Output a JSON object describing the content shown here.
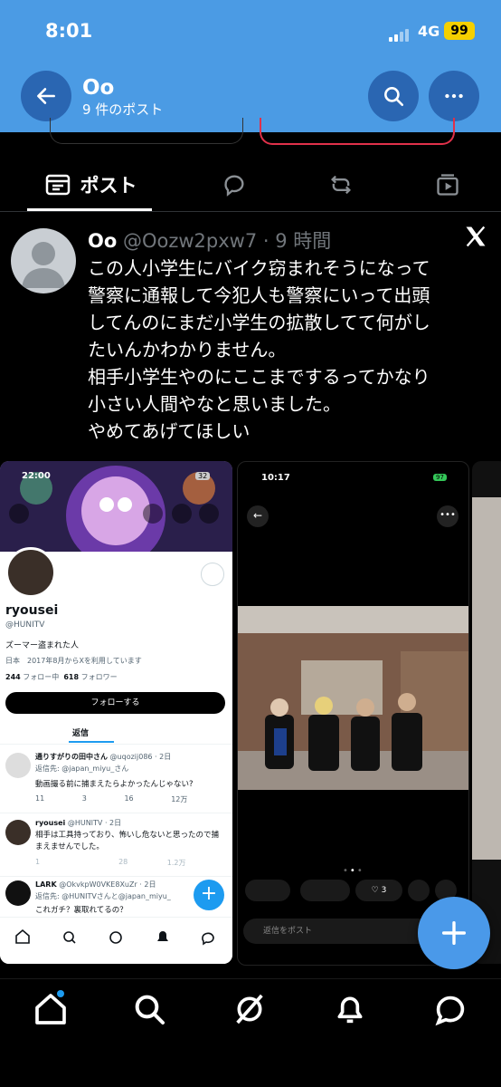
{
  "status_bar": {
    "time": "8:01",
    "network": "4G",
    "battery": "99"
  },
  "header": {
    "title": "Oo",
    "subtitle": "9 件のポスト"
  },
  "tabs": {
    "posts_label": "ポスト"
  },
  "tweet": {
    "display_name": "Oo",
    "handle_time": "@Oozw2pxw7 · 9 時間",
    "text": "この人小学生にバイク窃まれそうになって\n警察に通報して今犯人も警察にいって出頭\nしてんのにまだ小学生の拡散してて何がし\nたいんかわかりません。\n相手小学生やのにここまでするってかなり\n小さい人間やなと思いました。\nやめてあげてほしい"
  },
  "shot1": {
    "time": "22:00",
    "battery": "32",
    "name": "ryousei",
    "handle": "@HUNITV",
    "bio": "ズーマー盗まれた人",
    "meta": "日本　2017年8月からXを利用しています",
    "following_count": "244",
    "following_label": "フォロー中",
    "followers_count": "618",
    "followers_label": "フォロワー",
    "follow_button": "フォローする",
    "tab_replies": "返信",
    "reply1": {
      "name": "通りすがりの田中さん",
      "handle": "@uqozij086 · 2日",
      "reply_to": "返信先: @japan_miyu_さん",
      "text": "動画撮る前に捕まえたらよかったんじゃない?",
      "replies": "11",
      "reposts": "3",
      "likes": "16",
      "views": "12万"
    },
    "reply2": {
      "name": "ryousei",
      "handle": "@HUNITV · 2日",
      "text": "相手は工具持っており、怖いし危ないと思ったので捕まえませんでした。",
      "replies": "1",
      "reposts": "",
      "likes": "28",
      "views": "1.2万"
    },
    "reply3": {
      "name": "LARK",
      "handle": "@OkvkpW0VKE8XuZr · 2日",
      "reply_to": "返信先: @HUNITVさんと@japan_miyu_",
      "text": "これガチ？裏取れてるの？"
    }
  },
  "shot2": {
    "time": "10:17",
    "battery": "97",
    "likes": "3",
    "reply_placeholder": "返信をポスト"
  }
}
